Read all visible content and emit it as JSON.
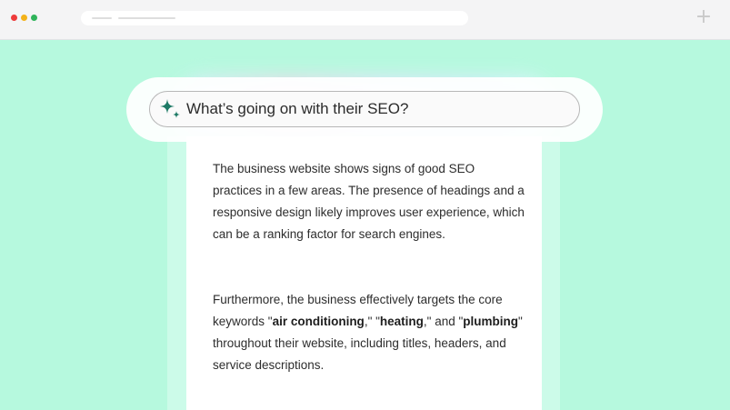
{
  "colors": {
    "page_background": "#b6f9de",
    "sparkle_icon": "#1e7a66",
    "text": "#2d2d2d"
  },
  "browser": {
    "window_controls": [
      "close",
      "minimize",
      "maximize"
    ],
    "new_tab_icon": "plus-icon"
  },
  "search": {
    "icon": "sparkle-icon",
    "query": "What’s going on with their SEO?"
  },
  "answer": {
    "paragraph1": "The business website shows signs of good SEO practices in a few areas. The presence of headings and a responsive design likely improves user experience, which can be a ranking factor for search engines.",
    "paragraph2": {
      "intro": "Furthermore, the business effectively targets the core keywords \"",
      "keyword1": "air conditioning",
      "sep1": ",\" \"",
      "keyword2": "heating",
      "sep2": ",\" and \"",
      "keyword3": "plumbing",
      "outro": "\" throughout their website, including titles, headers, and service descriptions."
    }
  }
}
